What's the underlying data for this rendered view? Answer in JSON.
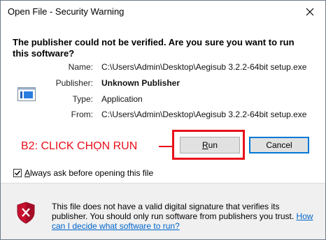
{
  "window": {
    "title": "Open File - Security Warning"
  },
  "dialog": {
    "heading": "The publisher could not be verified.  Are you sure you want to run this software?",
    "file_icon": "executable-file-icon",
    "fields": {
      "name_label": "Name:",
      "name_value": "C:\\Users\\Admin\\Desktop\\Aegisub 3.2.2-64bit setup.exe",
      "publisher_label": "Publisher:",
      "publisher_value": "Unknown Publisher",
      "type_label": "Type:",
      "type_value": "Application",
      "from_label": "From:",
      "from_value": "C:\\Users\\Admin\\Desktop\\Aegisub 3.2.2-64bit setup.exe"
    },
    "annotation": "B2: CLICK CHỌN RUN",
    "annotation_color": "#e8101a",
    "run_button": {
      "first_letter": "R",
      "rest": "un"
    },
    "cancel_button": "Cancel",
    "always_ask": {
      "first_letter": "A",
      "rest": "lways ask before opening this file",
      "checked": true
    },
    "warning": {
      "icon": "shield-x-icon",
      "text": "This file does not have a valid digital signature that verifies its publisher.  You should only run software from publishers you trust.",
      "link": "How can I decide what software to run?"
    }
  }
}
